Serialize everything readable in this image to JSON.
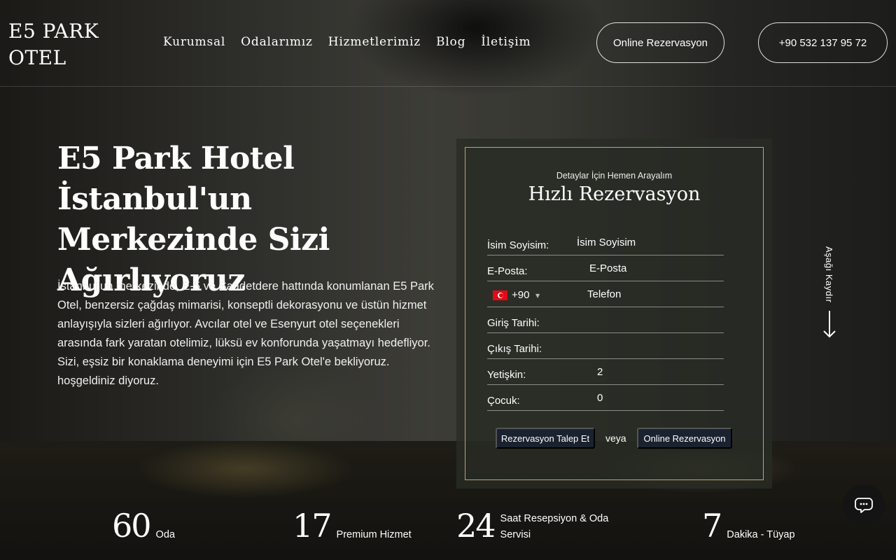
{
  "brand": {
    "line1": "E5 PARK",
    "line2": "OTEL"
  },
  "nav": [
    {
      "label": "Kurumsal"
    },
    {
      "label": "Odalarımız"
    },
    {
      "label": "Hizmetlerimiz"
    },
    {
      "label": "Blog"
    },
    {
      "label": "İletişim"
    }
  ],
  "header_buttons": {
    "online": "Online Rezervasyon",
    "phone": "+90 532 137 95 72"
  },
  "hero": {
    "title": "E5 Park Hotel İstanbul'un Merkezinde Sizi Ağırlıyoruz",
    "description": "İstanbul'un merkezinde, E-5 ve Saadetdere hattında konumlanan E5 Park Otel, benzersiz çağdaş mimarisi, konseptli dekorasyonu ve üstün hizmet anlayışıyla sizleri ağırlıyor. Avcılar otel ve Esenyurt otel seçenekleri arasında fark yaratan otelimiz, lüksü ev konforunda yaşatmayı hedefliyor. Sizi, eşsiz bir konaklama deneyimi için E5 Park Otel'e bekliyoruz. hoşgeldiniz diyoruz."
  },
  "booking": {
    "subtitle": "Detaylar İçin Hemen Arayalım",
    "title": "Hızlı Rezervasyon",
    "fields": {
      "name": {
        "label": "İsim Soyisim:",
        "placeholder": "İsim Soyisim"
      },
      "email": {
        "label": "E-Posta:",
        "placeholder": "E-Posta"
      },
      "phone": {
        "dial": "+90",
        "placeholder": "Telefon"
      },
      "checkin": {
        "label": "Giriş Tarihi:"
      },
      "checkout": {
        "label": "Çıkış Tarihi:"
      },
      "adults": {
        "label": "Yetişkin:",
        "value": "2"
      },
      "children": {
        "label": "Çocuk:",
        "value": "0"
      }
    },
    "request_button": "Rezervasyon Talep Et",
    "or": "veya",
    "online_button": "Online Rezervasyon"
  },
  "scroll_hint": "Aşağı Kaydır",
  "stats": [
    {
      "number": "60",
      "label": "Oda"
    },
    {
      "number": "17",
      "label": "Premium Hizmet"
    },
    {
      "number": "24",
      "label": "Saat Resepsiyon & Oda Servisi"
    },
    {
      "number": "7",
      "label": "Dakika - Tüyap"
    }
  ],
  "colors": {
    "card_border": "#b9a778",
    "button_dark": "#1a2230",
    "flag_red": "#e30a17"
  },
  "icons": {
    "chat": "chat-bubbles-icon",
    "scroll": "arrow-down-icon",
    "flag": "turkey-flag-icon"
  }
}
